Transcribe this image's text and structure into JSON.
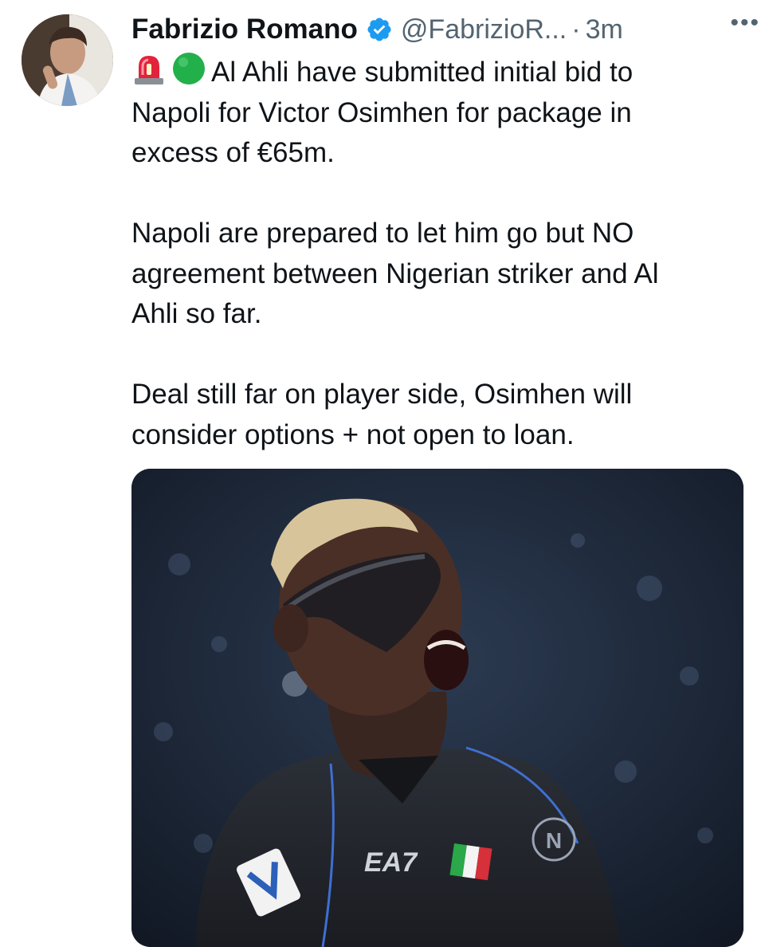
{
  "tweet": {
    "author_name": "Fabrizio Romano",
    "handle": "@FabrizioR...",
    "separator": "·",
    "time": "3m",
    "more": "•••",
    "line1": "Al Ahli have submitted initial bid to",
    "body_rest": "Napoli for Victor Osimhen for package in\nexcess of €65m.\n\nNapoli are prepared to let him go but NO\nagreement between Nigerian striker and Al\nAhli so far.\n\nDeal still far on player side, Osimhen will\nconsider options + not open to loan.",
    "emojis": [
      "rotating-light-icon",
      "green-circle-icon"
    ],
    "verified_color": "#1d9bf0",
    "media_alt": "Victor Osimhen celebrating in a black Napoli shirt and protective mask",
    "jersey_text": "EA7"
  }
}
